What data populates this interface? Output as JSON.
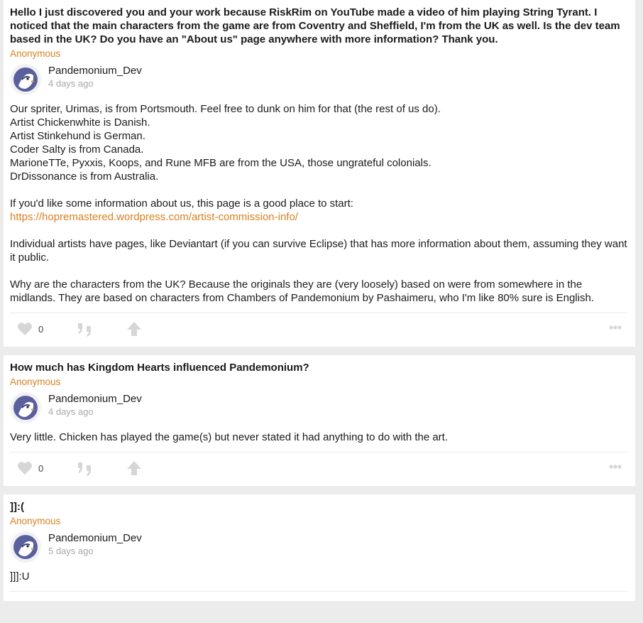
{
  "posts": [
    {
      "question": "Hello I just discovered you and your work because RiskRim on YouTube made a video of him playing String Tyrant. I noticed that the main characters from the game are from Coventry and Sheffield, I'm from the UK as well. Is the dev team based in the UK? Do you have an \"About us\" page anywhere with more information? Thank you.",
      "asker": "Anonymous",
      "author": "Pandemonium_Dev",
      "time": "4 days ago",
      "answer": {
        "l1": "Our spriter, Urimas, is from Portsmouth. Feel free to dunk on him for that (the rest of us do).",
        "l2": "Artist Chickenwhite is Danish.",
        "l3": "Artist Stinkehund is German.",
        "l4": "Coder Salty is from Canada.",
        "l5": "MarioneTTe, Pyxxis, Koops, and Rune MFB are from the USA, those ungrateful colonials.",
        "l6": "DrDissonance is from Australia.",
        "l7": "If you'd like some information about us, this page is a good place to start:",
        "link": "https://hopremastered.wordpress.com/artist-commission-info/",
        "p3": "Individual artists have pages, like Deviantart (if you can survive Eclipse) that has more information about them, assuming they want it public.",
        "p4": "Why are the characters from the UK? Because the originals they are (very loosely) based on were from somewhere in the midlands. They are based on characters from Chambers of Pandemonium by Pashaimeru, who I'm like 80% sure is English."
      },
      "likes": "0"
    },
    {
      "question": "How much has Kingdom Hearts influenced Pandemonium?",
      "asker": "Anonymous",
      "author": "Pandemonium_Dev",
      "time": "4 days ago",
      "answer": "Very little. Chicken has played the game(s) but never stated it had anything to do with the art.",
      "likes": "0"
    },
    {
      "question": "]]:(",
      "asker": "Anonymous",
      "author": "Pandemonium_Dev",
      "time": "5 days ago",
      "answer": "]]]:U"
    }
  ],
  "colors": {
    "accent": "#d9801f",
    "muted": "#a8a8a8",
    "icon": "#d6d6d6",
    "background": "#ececec"
  },
  "icons": [
    "heart-icon",
    "reply-icon",
    "reblog-icon",
    "more-icon"
  ]
}
